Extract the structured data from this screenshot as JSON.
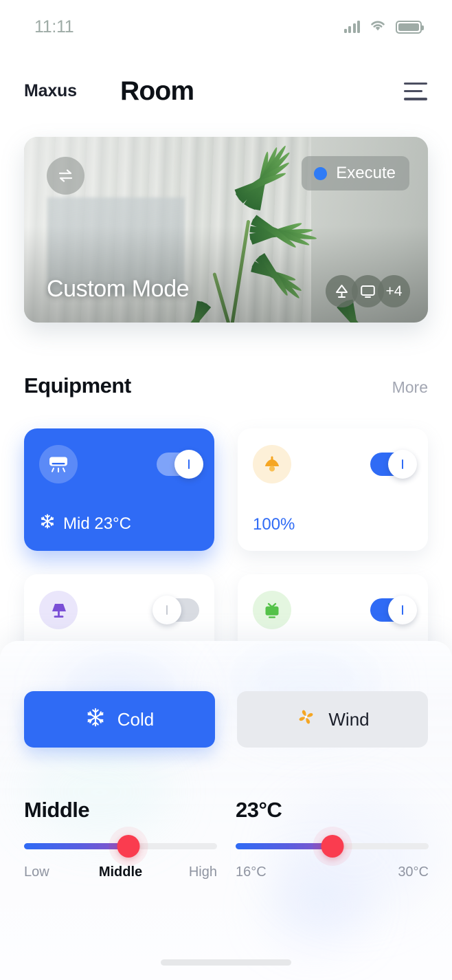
{
  "status_bar": {
    "time": "11:11",
    "icons": [
      "cellular-signal-icon",
      "wifi-icon",
      "battery-icon"
    ]
  },
  "header": {
    "brand": "Maxus",
    "title": "Room",
    "menu_icon": "hamburger-menu-icon"
  },
  "scene_card": {
    "name": "Custom Mode",
    "swap_icon": "swap-arrows-icon",
    "execute_label": "Execute",
    "execute_dot_color": "#2f7bf6",
    "devices": [
      {
        "icon": "desk-lamp-icon",
        "label": ""
      },
      {
        "icon": "monitor-icon",
        "label": ""
      },
      {
        "icon": "more-count-badge",
        "label": "+4"
      }
    ]
  },
  "equipment": {
    "title": "Equipment",
    "more_label": "More",
    "cards": [
      {
        "name": "air-conditioner",
        "icon": "air-conditioner-icon",
        "active": true,
        "toggle_on": true,
        "status_icon": "snowflake-icon",
        "status_text": "Mid  23°C"
      },
      {
        "name": "ceiling-light",
        "icon": "ceiling-lamp-icon",
        "active": false,
        "toggle_on": true,
        "status_icon": "",
        "status_text": "100%"
      },
      {
        "name": "table-lamp",
        "icon": "table-lamp-icon",
        "active": false,
        "toggle_on": false,
        "status_icon": "",
        "status_text": ""
      },
      {
        "name": "television",
        "icon": "tv-icon",
        "active": false,
        "toggle_on": true,
        "status_icon": "",
        "status_text": ""
      }
    ]
  },
  "bottom_sheet": {
    "modes": [
      {
        "label": "Cold",
        "icon": "snowflake-icon",
        "selected": true
      },
      {
        "label": "Wind",
        "icon": "fan-icon",
        "selected": false
      }
    ],
    "fan_speed": {
      "value": "Middle",
      "percent": 54,
      "label_low": "Low",
      "label_mid": "Middle",
      "label_high": "High"
    },
    "temperature": {
      "value": "23°C",
      "percent": 50,
      "label_min": "16°C",
      "label_max": "30°C"
    }
  },
  "theme": {
    "accent": "#2f6bf5",
    "slider_thumb": "#fa3c4f",
    "slider_gradient_from": "#2f6bf5",
    "slider_gradient_to": "#8e53c4",
    "amber": "#f5a623",
    "purple": "#7a4fd6",
    "green": "#55c24a",
    "muted_text": "#8f94a1"
  }
}
